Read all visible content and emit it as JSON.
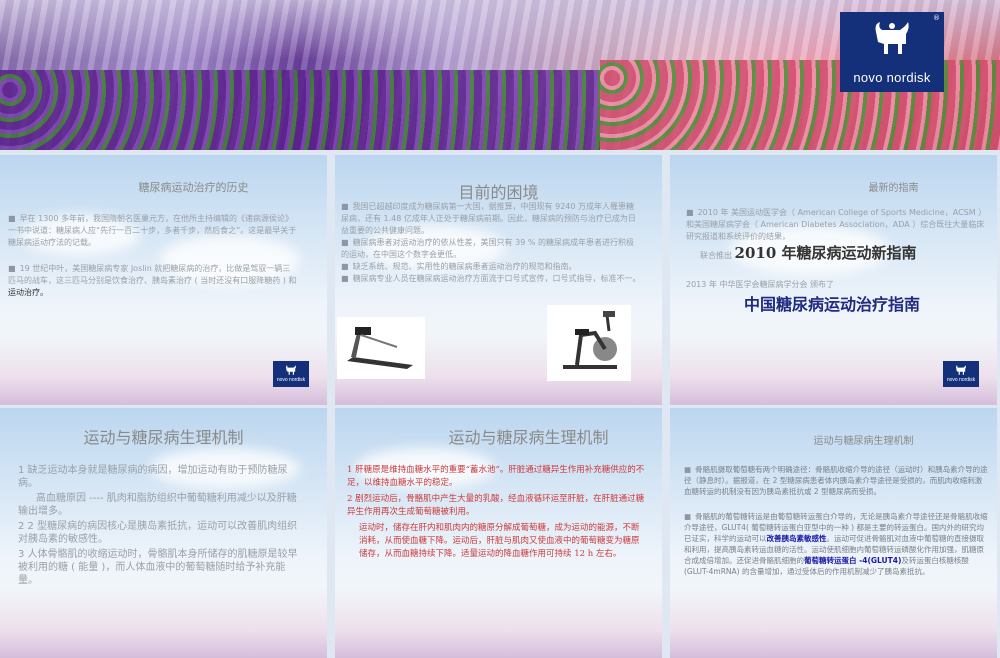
{
  "header": {
    "brand": "novo nordisk",
    "reg": "®"
  },
  "slides": [
    {
      "title": "糖尿病运动治疗的历史",
      "p1": "早在 1300 多年前，我国隋朝名医巢元方，在他所主持编辑的《诸病源侯论》一书中说道：糖尿病人应“先行一百二十步，多者千步，然后食之”。这是最早关于糖尿病运动疗法的记载。",
      "p2": "19 世纪中叶，美国糖尿病专家 Joslin 就把糖尿病的治疗，比做是驾驭一辆三匹马的战车，这三匹马分别是饮食治疗、胰岛素治疗 ( 当时还没有口服降糖药 ) 和",
      "p2_tail": "运动治疗。"
    },
    {
      "title": "目前的困境",
      "items": [
        "我国已超越印度成为糖尿病第一大国，据推算，中国现有 9240 万成年人罹患糖尿病，还有 1.48 亿成年人正处于糖尿病前期。因此，糖尿病的预防与治疗已成为日益重要的公共健康问题。",
        "糖尿病患者对运动治疗的依从性差，美国只有 39 % 的糖尿病成年患者进行积极的运动，在中国这个数字会更低。",
        "缺乏系统、规范、实用性的糖尿病患者运动治疗的规范和指南。",
        "糖尿病专业人员在糖尿病运动治疗方面流于口号式宣传，口号式指导，标准不一。"
      ]
    },
    {
      "title": "最新的指南",
      "p1": "2010 年   美国运动医学会（ American College of Sports Medicine，ACSM ）和美国糖尿病学会（ American Diabetes Association，ADA ）综合既往大量临床研究报道和系统评价的结果，",
      "p1b": "联合推出",
      "p1_big": "2010 年糖尿病运动新指南",
      "p2": "2013 年   中华医学会糖尿病学分会   颁布了",
      "p2_big": "中国糖尿病运动治疗指南"
    },
    {
      "title": "运动与糖尿病生理机制",
      "items": [
        "1  缺乏运动本身就是糖尿病的病因，增加运动有助于预防糖尿病。",
        "高血糖原因 ---- 肌肉和脂肪组织中葡萄糖利用减少以及肝糖输出增多。",
        "2 2 型糖尿病的病因核心是胰岛素抵抗，运动可以改善肌肉组织对胰岛素的敏感性。",
        "3  人体骨骼肌的收缩运动时，骨骼肌本身所储存的肌糖原是较早被利用的糖 ( 能量 )，而人体血液中的葡萄糖随时给予补充能量。"
      ]
    },
    {
      "title": "运动与糖尿病生理机制",
      "items": [
        "1   肝糖原是维持血糖水平的重要“蓄水池”。肝脏通过糖异生作用补充糖供应的不足，以维持血糖水平的稳定。",
        "2   剧烈运动后，骨骼肌中产生大量的乳酸，经血液循环运至肝脏，在肝脏通过糖异生作用再次生成葡萄糖被利用。",
        "运动时，储存在肝内和肌肉内的糖原分解成葡萄糖，成为运动的能源，不断消耗，从而使血糖下降。运动后，肝脏与肌肉又使血液中的葡萄糖变为糖原储存，从而血糖持续下降。适量运动的降血糖作用可持续 12 h 左右。"
      ]
    },
    {
      "title": "运动与糖尿病生理机制",
      "p1": "骨骼肌摄取葡萄糖有两个明确途径：骨骼肌收缩介导的途径（运动时）和胰岛素介导的途径（静息时）。据报道，在 2 型糖尿病患者体内胰岛素介导途径是受损的，而肌肉收缩刺激血糖转运的机制没有因为胰岛素抵抗或 2 型糖尿病而受损。",
      "p2a": "骨骼肌的葡萄糖转运是由葡萄糖转运蛋白介导的，无论是胰岛素介导途径还是骨骼肌收缩介导途径，GLUT4( 葡萄糖转运蛋白亚型中的一种 ) 都是主要的转运蛋白。国内外的研究均已证实，科学的运动可以",
      "p2_blue1": "改善胰岛素敏感性",
      "p2b": "。运动可促进骨骼肌对血液中葡萄糖的直接摄取和利用，提高胰岛素转运血糖的活性。运动使肌细胞内葡萄糖转运磷酸化作用加强，肌糖原合成成倍增加。还促进骨骼肌细胞的",
      "p2_blue2": "葡萄糖转运蛋白 -4(GLUT4)",
      "p2c": "及转运蛋白核糖核酸 (GLUT-4mRNA) 的含量增加，通过受体后的作用机制减少了胰岛素抵抗。"
    }
  ]
}
